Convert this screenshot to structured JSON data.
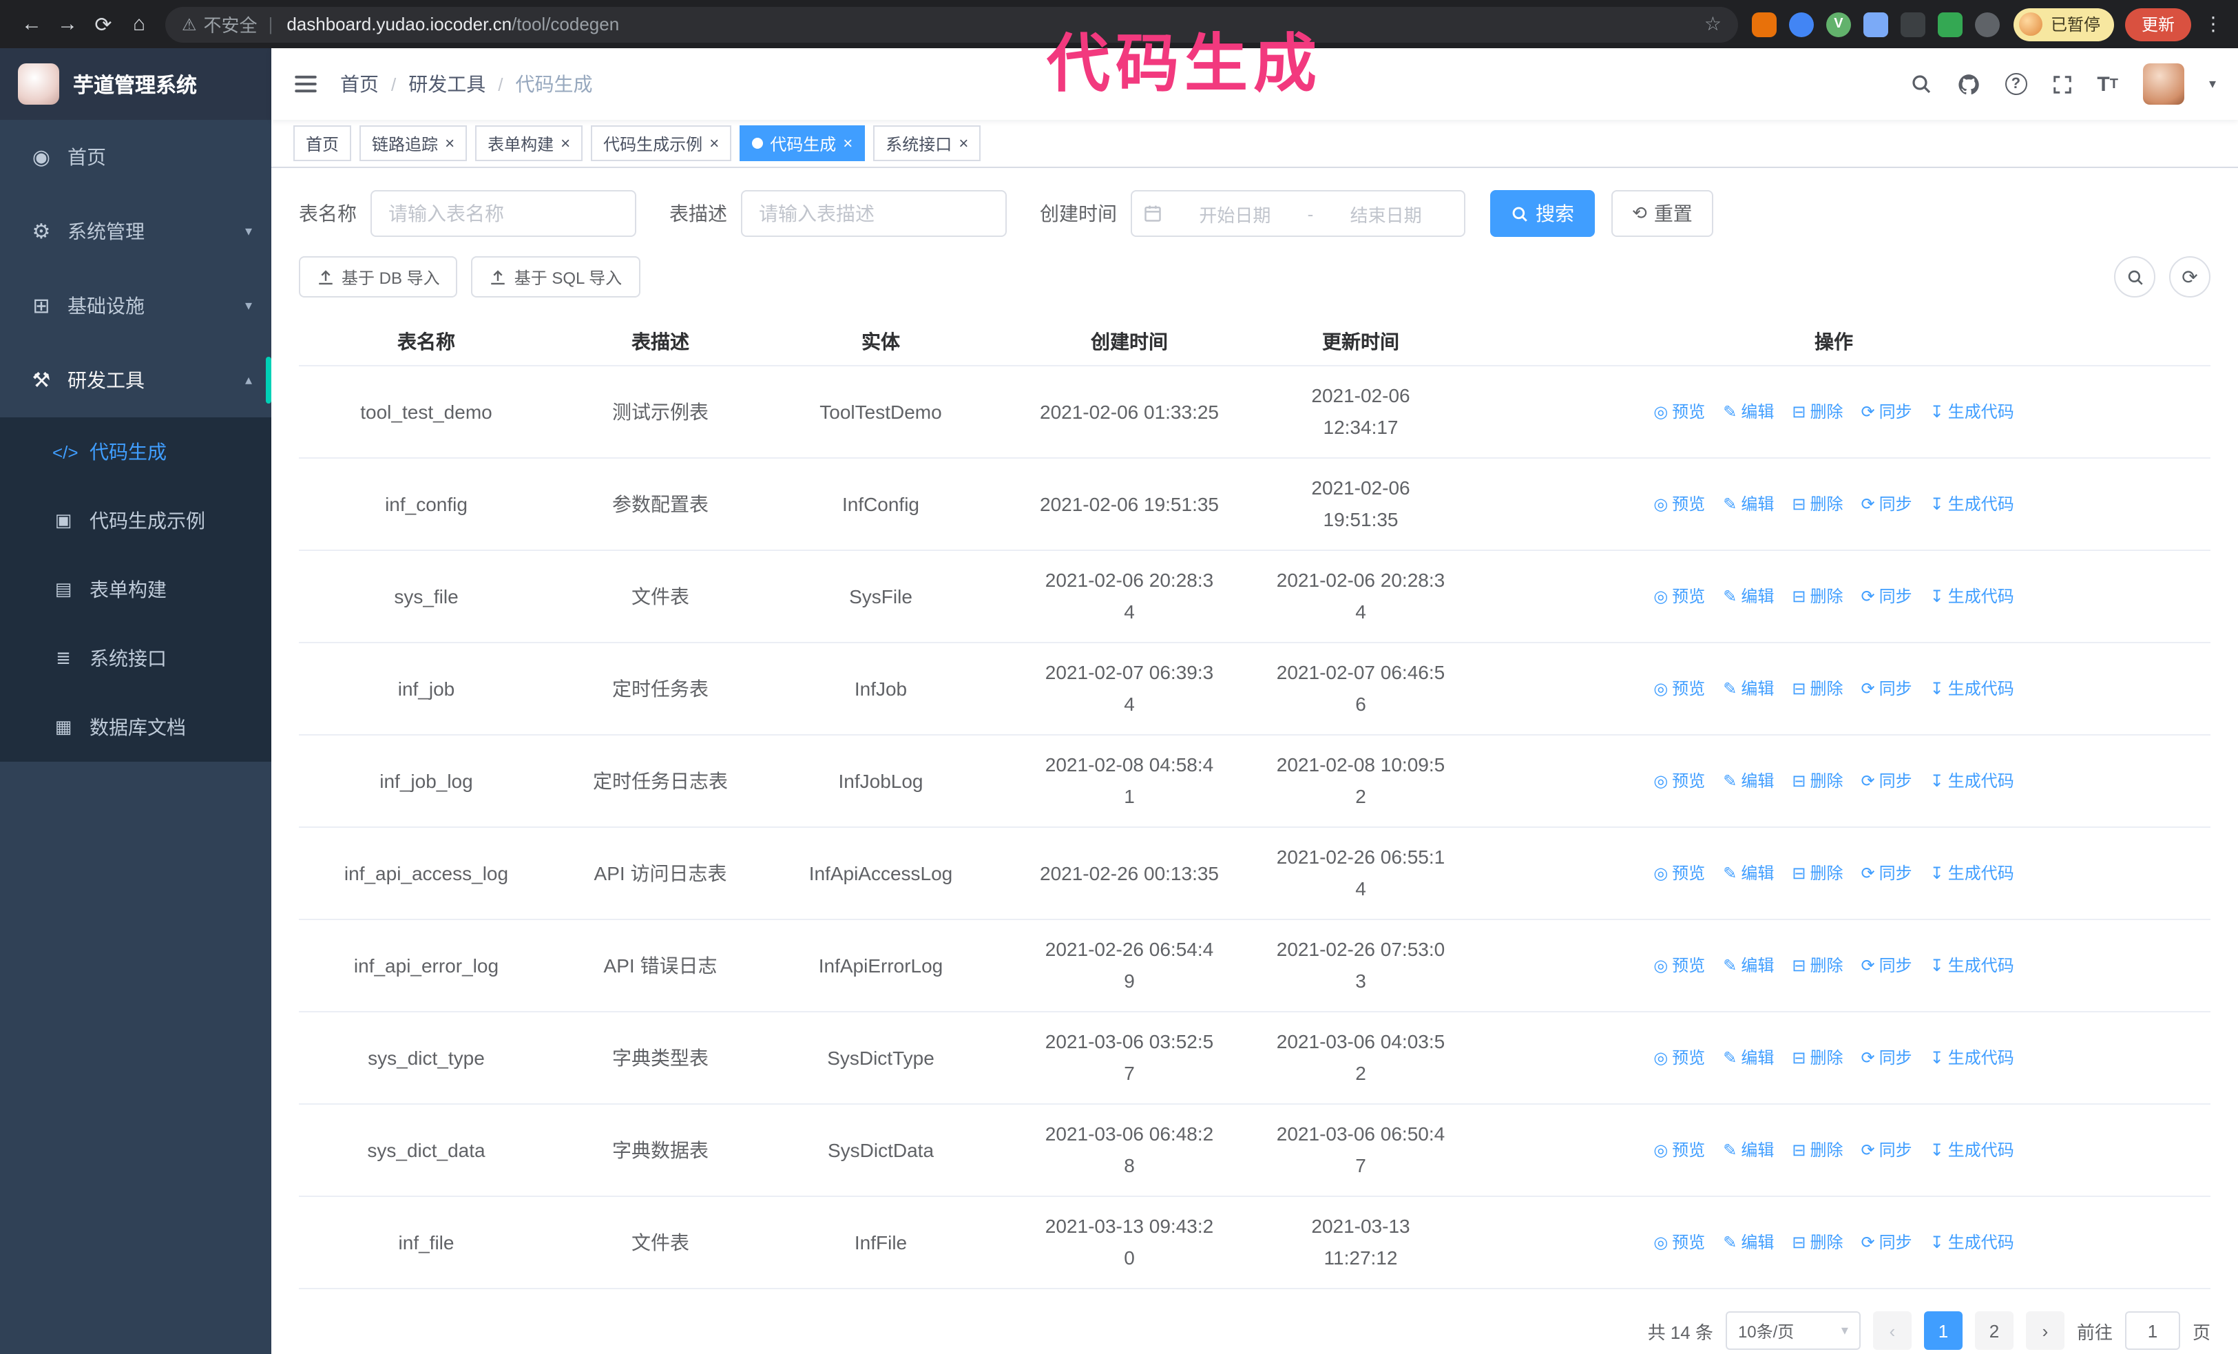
{
  "colors": {
    "accent": "#409eff",
    "annotation": "#f2397e",
    "sidebar_bg": "#304156",
    "submenu_bg": "#1f2d3d",
    "active_indicator": "#00d0b6"
  },
  "annotation": {
    "text": "代码生成"
  },
  "browser": {
    "security_label": "不安全",
    "url_host": "dashboard.yudao.iocoder.cn",
    "url_path": "/tool/codegen",
    "paused_badge": "已暂停",
    "update_button": "更新"
  },
  "sidebar": {
    "app_title": "芋道管理系统",
    "items": [
      {
        "label": "首页"
      },
      {
        "label": "系统管理"
      },
      {
        "label": "基础设施"
      },
      {
        "label": "研发工具"
      }
    ],
    "subitems": [
      {
        "label": "代码生成"
      },
      {
        "label": "代码生成示例"
      },
      {
        "label": "表单构建"
      },
      {
        "label": "系统接口"
      },
      {
        "label": "数据库文档"
      }
    ]
  },
  "navbar": {
    "breadcrumb": [
      "首页",
      "研发工具",
      "代码生成"
    ]
  },
  "tabs": [
    {
      "label": "首页"
    },
    {
      "label": "链路追踪"
    },
    {
      "label": "表单构建"
    },
    {
      "label": "代码生成示例"
    },
    {
      "label": "代码生成"
    },
    {
      "label": "系统接口"
    }
  ],
  "filters": {
    "table_name_label": "表名称",
    "table_name_placeholder": "请输入表名称",
    "table_desc_label": "表描述",
    "table_desc_placeholder": "请输入表描述",
    "create_time_label": "创建时间",
    "date_start_placeholder": "开始日期",
    "date_separator": "-",
    "date_end_placeholder": "结束日期",
    "search_button": "搜索",
    "reset_button": "重置"
  },
  "toolbar": {
    "import_db": "基于 DB 导入",
    "import_sql": "基于 SQL 导入"
  },
  "table": {
    "columns": [
      "表名称",
      "表描述",
      "实体",
      "创建时间",
      "更新时间",
      "操作"
    ],
    "actions": [
      {
        "key": "preview",
        "label": "预览"
      },
      {
        "key": "edit",
        "label": "编辑"
      },
      {
        "key": "delete",
        "label": "删除"
      },
      {
        "key": "sync",
        "label": "同步"
      },
      {
        "key": "generate",
        "label": "生成代码"
      }
    ],
    "rows": [
      {
        "name": "tool_test_demo",
        "desc": "测试示例表",
        "entity": "ToolTestDemo",
        "created": "2021-02-06 01:33:25",
        "updated": "2021-02-06 12:34:17"
      },
      {
        "name": "inf_config",
        "desc": "参数配置表",
        "entity": "InfConfig",
        "created": "2021-02-06 19:51:35",
        "updated": "2021-02-06 19:51:35"
      },
      {
        "name": "sys_file",
        "desc": "文件表",
        "entity": "SysFile",
        "created": "2021-02-06 20:28:3\n4",
        "updated": "2021-02-06 20:28:3\n4"
      },
      {
        "name": "inf_job",
        "desc": "定时任务表",
        "entity": "InfJob",
        "created": "2021-02-07 06:39:3\n4",
        "updated": "2021-02-07 06:46:5\n6"
      },
      {
        "name": "inf_job_log",
        "desc": "定时任务日志表",
        "entity": "InfJobLog",
        "created": "2021-02-08 04:58:4\n1",
        "updated": "2021-02-08 10:09:5\n2"
      },
      {
        "name": "inf_api_access_log",
        "desc": "API 访问日志表",
        "entity": "InfApiAccessLog",
        "created": "2021-02-26 00:13:35",
        "updated": "2021-02-26 06:55:1\n4"
      },
      {
        "name": "inf_api_error_log",
        "desc": "API 错误日志",
        "entity": "InfApiErrorLog",
        "created": "2021-02-26 06:54:4\n9",
        "updated": "2021-02-26 07:53:0\n3"
      },
      {
        "name": "sys_dict_type",
        "desc": "字典类型表",
        "entity": "SysDictType",
        "created": "2021-03-06 03:52:5\n7",
        "updated": "2021-03-06 04:03:5\n2"
      },
      {
        "name": "sys_dict_data",
        "desc": "字典数据表",
        "entity": "SysDictData",
        "created": "2021-03-06 06:48:2\n8",
        "updated": "2021-03-06 06:50:4\n7"
      },
      {
        "name": "inf_file",
        "desc": "文件表",
        "entity": "InfFile",
        "created": "2021-03-13 09:43:2\n0",
        "updated": "2021-03-13 11:27:12"
      }
    ]
  },
  "pagination": {
    "total_text": "共 14 条",
    "page_size": "10条/页",
    "pages": [
      "1",
      "2"
    ],
    "active_page": "1",
    "goto_label": "前往",
    "goto_value": "1",
    "page_label": "页"
  }
}
